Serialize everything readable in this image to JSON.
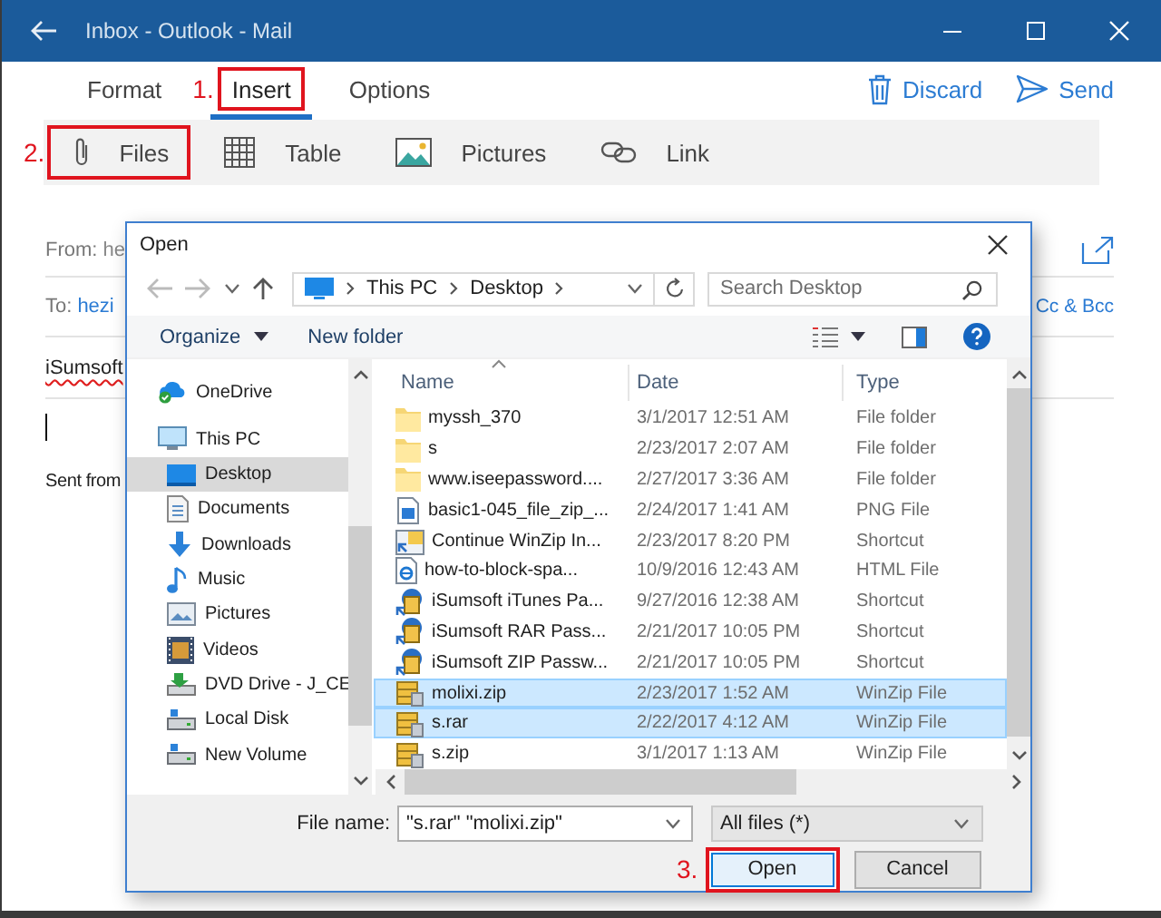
{
  "window": {
    "title": "Inbox - Outlook - Mail"
  },
  "ribbon": {
    "tabs": [
      {
        "label": "Format",
        "selected": false,
        "highlighted": false
      },
      {
        "label": "Insert",
        "selected": true,
        "highlighted": true,
        "step": "1."
      },
      {
        "label": "Options",
        "selected": false,
        "highlighted": false
      }
    ],
    "actions": [
      {
        "kind": "discard",
        "label": "Discard"
      },
      {
        "kind": "send",
        "label": "Send"
      }
    ],
    "tools": [
      {
        "kind": "files",
        "label": "Files",
        "highlighted": true,
        "step": "2."
      },
      {
        "kind": "table",
        "label": "Table",
        "highlighted": false
      },
      {
        "kind": "pictures",
        "label": "Pictures",
        "highlighted": false
      },
      {
        "kind": "link",
        "label": "Link",
        "highlighted": false
      }
    ]
  },
  "compose": {
    "from_label": "From:",
    "from_value": "he",
    "to_label": "To:",
    "to_value": "hezi",
    "cc_bcc": "Cc & Bcc",
    "subject": "iSumsoft",
    "signature": "Sent from"
  },
  "dialog": {
    "title": "Open",
    "path": [
      "This PC",
      "Desktop"
    ],
    "search": {
      "placeholder": "Search Desktop"
    },
    "toolbar": {
      "organize": "Organize",
      "new_folder": "New folder"
    },
    "nav": [
      {
        "label": "OneDrive",
        "kind": "cloud",
        "selected": false
      },
      {
        "label": "This PC",
        "kind": "pc",
        "selected": false,
        "children": [
          {
            "label": "Desktop",
            "kind": "desktop",
            "selected": true
          },
          {
            "label": "Documents",
            "kind": "documents",
            "selected": false
          },
          {
            "label": "Downloads",
            "kind": "downloads",
            "selected": false
          },
          {
            "label": "Music",
            "kind": "music",
            "selected": false
          },
          {
            "label": "Pictures",
            "kind": "pictures",
            "selected": false
          },
          {
            "label": "Videos",
            "kind": "videos",
            "selected": false
          },
          {
            "label": "DVD Drive - J_CE",
            "kind": "dvd",
            "selected": false
          },
          {
            "label": "Local Disk",
            "kind": "disk",
            "selected": false
          },
          {
            "label": "New Volume",
            "kind": "disk",
            "selected": false
          }
        ]
      }
    ],
    "columns": [
      "Name",
      "Date",
      "Type"
    ],
    "files": [
      {
        "name": "myssh_370",
        "date": "3/1/2017 12:51 AM",
        "type": "File folder",
        "kind": "folder",
        "selected": false
      },
      {
        "name": "s",
        "date": "2/23/2017 2:07 AM",
        "type": "File folder",
        "kind": "folder",
        "selected": false
      },
      {
        "name": "www.iseepassword....",
        "date": "2/27/2017 3:36 AM",
        "type": "File folder",
        "kind": "folder",
        "selected": false
      },
      {
        "name": "basic1-045_file_zip_...",
        "date": "2/24/2017 1:41 AM",
        "type": "PNG File",
        "kind": "image",
        "selected": false
      },
      {
        "name": "Continue WinZip In...",
        "date": "2/23/2017 8:20 PM",
        "type": "Shortcut",
        "kind": "shortcut",
        "selected": false
      },
      {
        "name": "how-to-block-spa...",
        "date": "10/9/2016 12:43 AM",
        "type": "HTML File",
        "kind": "html",
        "selected": false
      },
      {
        "name": "iSumsoft iTunes Pa...",
        "date": "9/27/2016 12:38 AM",
        "type": "Shortcut",
        "kind": "app",
        "selected": false
      },
      {
        "name": "iSumsoft RAR Pass...",
        "date": "2/21/2017 10:05 PM",
        "type": "Shortcut",
        "kind": "app",
        "selected": false
      },
      {
        "name": "iSumsoft ZIP Passw...",
        "date": "2/21/2017 10:05 PM",
        "type": "Shortcut",
        "kind": "app",
        "selected": false
      },
      {
        "name": "molixi.zip",
        "date": "2/23/2017 1:52 AM",
        "type": "WinZip File",
        "kind": "archive",
        "selected": true
      },
      {
        "name": "s.rar",
        "date": "2/22/2017 4:12 AM",
        "type": "WinZip File",
        "kind": "archive",
        "selected": true
      },
      {
        "name": "s.zip",
        "date": "3/1/2017 1:13 AM",
        "type": "WinZip File",
        "kind": "archive",
        "selected": false
      }
    ],
    "file_name": {
      "label": "File name:",
      "value": "\"s.rar\" \"molixi.zip\""
    },
    "file_type": {
      "value": "All files (*)"
    },
    "buttons": [
      {
        "label": "Open",
        "kind": "primary",
        "highlighted": true,
        "step": "3."
      },
      {
        "label": "Cancel",
        "kind": "secondary",
        "highlighted": false
      }
    ]
  }
}
